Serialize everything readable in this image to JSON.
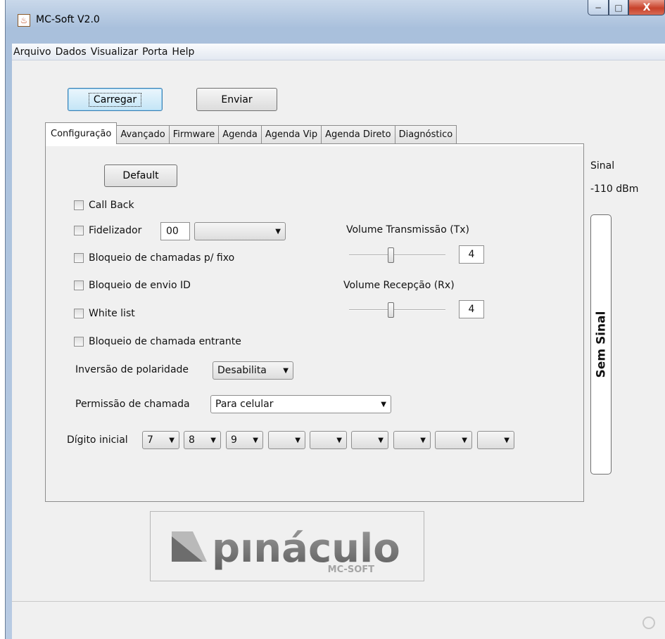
{
  "window": {
    "title": "MC-Soft V2.0",
    "minimize": "−",
    "maximize": "□",
    "close": "X"
  },
  "menu": [
    "Arquivo",
    "Dados",
    "Visualizar",
    "Porta",
    "Help"
  ],
  "toolbar": {
    "load_label": "Carregar",
    "send_label": "Enviar"
  },
  "tabs": [
    "Configuração",
    "Avançado",
    "Firmware",
    "Agenda",
    "Agenda Vip",
    "Agenda Direto",
    "Diagnóstico"
  ],
  "config": {
    "default_label": "Default",
    "callback_label": "Call Back",
    "fidelizador_label": "Fidelizador",
    "fidelizador_value": "00",
    "fidelizador_select": "",
    "block_fixed_label": "Bloqueio de chamadas p/ fixo",
    "block_id_label": "Bloqueio de envio ID",
    "whitelist_label": "White list",
    "block_incoming_label": "Bloqueio de chamada entrante",
    "vol_tx_label": "Volume Transmissão (Tx)",
    "vol_tx_value": "4",
    "vol_rx_label": "Volume Recepção (Rx)",
    "vol_rx_value": "4",
    "polarity_label": "Inversão de polaridade",
    "polarity_value": "Desabilita",
    "call_perm_label": "Permissão de chamada",
    "call_perm_value": "Para celular",
    "initial_digit_label": "Dígito inicial",
    "digits": [
      "7",
      "8",
      "9",
      "",
      "",
      "",
      "",
      "",
      ""
    ]
  },
  "signal": {
    "label": "Sinal",
    "dbm": "-110 dBm",
    "status": "Sem Sinal"
  },
  "logo": {
    "brand": "pınáculo",
    "sub": "MC-SOFT"
  }
}
